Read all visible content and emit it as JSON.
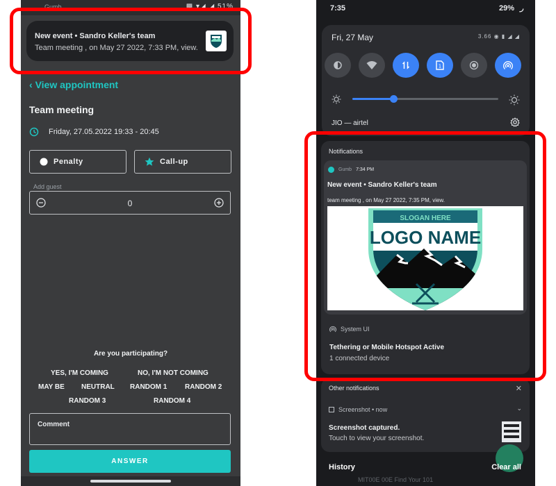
{
  "left": {
    "status": {
      "app_name": "Gumb",
      "icons": "▩ ▾◢ ◢ 51%"
    },
    "notification": {
      "title": "New event • Sandro Keller's team",
      "body": "Team meeting , on May 27 2022, 7:33 PM, view."
    },
    "back_label": "View appointment",
    "event": {
      "title": "Team meeting",
      "datetime": "Friday, 27.05.2022 19:33 - 20:45"
    },
    "buttons": {
      "penalty": "Penalty",
      "callup": "Call-up"
    },
    "guest": {
      "label": "Add guest",
      "value": "0"
    },
    "participation": {
      "question": "Are you participating?",
      "options": [
        "YES, I'M COMING",
        "NO, I'M NOT COMING",
        "MAY BE",
        "NEUTRAL",
        "RANDOM 1",
        "RANDOM 2",
        "RANDOM 3",
        "RANDOM 4"
      ]
    },
    "comment_label": "Comment",
    "answer_label": "ANSWER"
  },
  "right": {
    "status": {
      "time": "7:35",
      "battery": "29%"
    },
    "quick_settings": {
      "date": "Fri, 27 May",
      "status_icons": "3.66 ◉ ▮ ◢ ◢",
      "carrier": "JIO — airtel",
      "tiles": [
        {
          "icon": "data-saver-icon",
          "state": "off"
        },
        {
          "icon": "wifi-icon",
          "state": "off"
        },
        {
          "icon": "mobile-data-icon",
          "state": "on"
        },
        {
          "icon": "sim-icon",
          "state": "on"
        },
        {
          "icon": "focus-icon",
          "state": "off"
        },
        {
          "icon": "hotspot-icon",
          "state": "on"
        }
      ],
      "brightness": 0.28
    },
    "notifications": {
      "header": "Notifications",
      "app": {
        "app_name": "Gumb",
        "time": "7:34 PM",
        "title": "New event • Sandro Keller's team",
        "body": "team meeting , on May 27 2022, 7:35 PM, view.",
        "logo": {
          "slogan": "SLOGAN HERE",
          "name": "LOGO NAME"
        }
      },
      "system": {
        "source": "System UI",
        "title": "Tethering or Mobile Hotspot Active",
        "body": "1 connected device"
      }
    },
    "other": {
      "header": "Other notifications",
      "close": "✕",
      "screenshot": {
        "meta": "Screenshot • now",
        "title": "Screenshot captured.",
        "body": "Touch to view your screenshot."
      }
    },
    "footer": {
      "history": "History",
      "clear_all": "Clear all",
      "behind_text": "MIT00E 00E Find Your 101"
    }
  },
  "colors": {
    "accent": "#1fc6c2",
    "qs_on": "#3b82f6",
    "highlight": "#ff0000"
  }
}
